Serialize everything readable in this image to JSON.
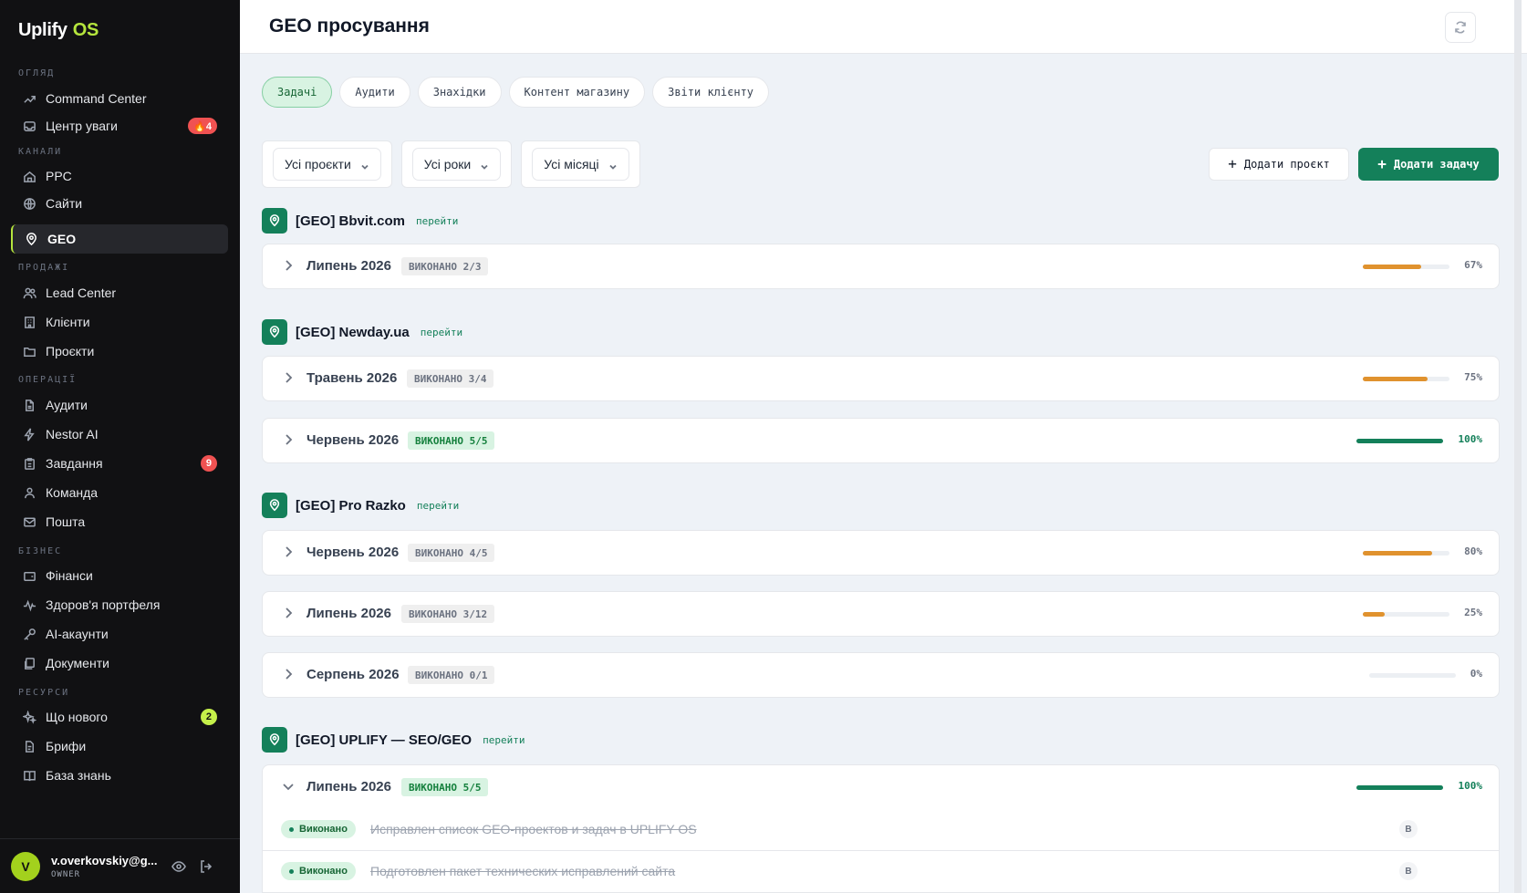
{
  "app": {
    "name": "Uplify",
    "name_suffix": "OS"
  },
  "sidebar": {
    "sections": [
      {
        "label": "ОГЛЯД"
      },
      {
        "label": "КАНАЛИ"
      },
      {
        "label": "ПРОДАЖІ"
      },
      {
        "label": "ОПЕРАЦІЇ"
      },
      {
        "label": "БІЗНЕС"
      },
      {
        "label": "РЕСУРСИ"
      }
    ],
    "items": [
      {
        "label": "Command Center",
        "icon": "trend-icon"
      },
      {
        "label": "Центр уваги",
        "icon": "inbox-icon",
        "badge": "🔥4"
      },
      {
        "label": "PPC",
        "icon": "home-icon"
      },
      {
        "label": "Сайти",
        "icon": "globe-icon"
      },
      {
        "label": "GEO",
        "icon": "pin-icon",
        "active": true
      },
      {
        "label": "Lead Center",
        "icon": "users-icon"
      },
      {
        "label": "Клієнти",
        "icon": "building-icon"
      },
      {
        "label": "Проєкти",
        "icon": "folder-icon"
      },
      {
        "label": "Аудити",
        "icon": "file-icon"
      },
      {
        "label": "Nestor AI",
        "icon": "bolt-icon"
      },
      {
        "label": "Завдання",
        "icon": "clipboard-icon",
        "badge": "9"
      },
      {
        "label": "Команда",
        "icon": "team-icon"
      },
      {
        "label": "Пошта",
        "icon": "mail-icon"
      },
      {
        "label": "Фінанси",
        "icon": "wallet-icon"
      },
      {
        "label": "Здоров'я портфеля",
        "icon": "pulse-icon"
      },
      {
        "label": "AI-акаунти",
        "icon": "key-icon"
      },
      {
        "label": "Документи",
        "icon": "docs-icon"
      },
      {
        "label": "Що нового",
        "icon": "sparkle-icon",
        "badge": "2"
      },
      {
        "label": "Брифи",
        "icon": "brief-icon"
      },
      {
        "label": "База знань",
        "icon": "book-icon"
      }
    ],
    "user": {
      "initial": "V",
      "email": "v.overkovskiy@g...",
      "role": "OWNER"
    }
  },
  "header": {
    "title": "GEO просування"
  },
  "tabs": [
    {
      "label": "Задачі",
      "active": true
    },
    {
      "label": "Аудити"
    },
    {
      "label": "Знахідки"
    },
    {
      "label": "Контент магазину"
    },
    {
      "label": "Звіти клієнту"
    }
  ],
  "filters": {
    "projects": "Усі проєкти",
    "years": "Усі роки",
    "months": "Усі місяці"
  },
  "actions": {
    "add_project": "Додати проєкт",
    "add_task": "Додати задачу"
  },
  "project_link_label": "перейти",
  "projects": [
    {
      "name": "[GEO] Bbvit.com",
      "months": [
        {
          "label": "Липень 2026",
          "status": "ВИКОНАНО 2/3",
          "progress": 0.67,
          "pct": "67%",
          "complete": false
        }
      ]
    },
    {
      "name": "[GEO] Newday.ua",
      "months": [
        {
          "label": "Травень 2026",
          "status": "ВИКОНАНО 3/4",
          "progress": 0.75,
          "pct": "75%",
          "complete": false
        },
        {
          "label": "Червень 2026",
          "status": "ВИКОНАНО 5/5",
          "progress": 1.0,
          "pct": "100%",
          "complete": true
        }
      ]
    },
    {
      "name": "[GEO] Pro Razko",
      "months": [
        {
          "label": "Червень 2026",
          "status": "ВИКОНАНО 4/5",
          "progress": 0.8,
          "pct": "80%",
          "complete": false
        },
        {
          "label": "Липень 2026",
          "status": "ВИКОНАНО 3/12",
          "progress": 0.25,
          "pct": "25%",
          "complete": false
        },
        {
          "label": "Серпень 2026",
          "status": "ВИКОНАНО 0/1",
          "progress": 0.0,
          "pct": "0%",
          "complete": false
        }
      ]
    },
    {
      "name": "[GEO] UPLIFY — SEO/GEO",
      "months": [
        {
          "label": "Липень 2026",
          "status": "ВИКОНАНО 5/5",
          "progress": 1.0,
          "pct": "100%",
          "complete": true,
          "expanded": true,
          "tasks": [
            {
              "status": "Виконано",
              "title": "Исправлен список GEO-проектов и задач в UPLIFY OS",
              "assignee": "B"
            },
            {
              "status": "Виконано",
              "title": "Подготовлен пакет технических исправлений сайта",
              "assignee": "B"
            }
          ]
        }
      ]
    }
  ],
  "colors": {
    "accent": "#14805a",
    "brand_lime": "#b5e53d",
    "progress_partial": "#e0922e"
  }
}
